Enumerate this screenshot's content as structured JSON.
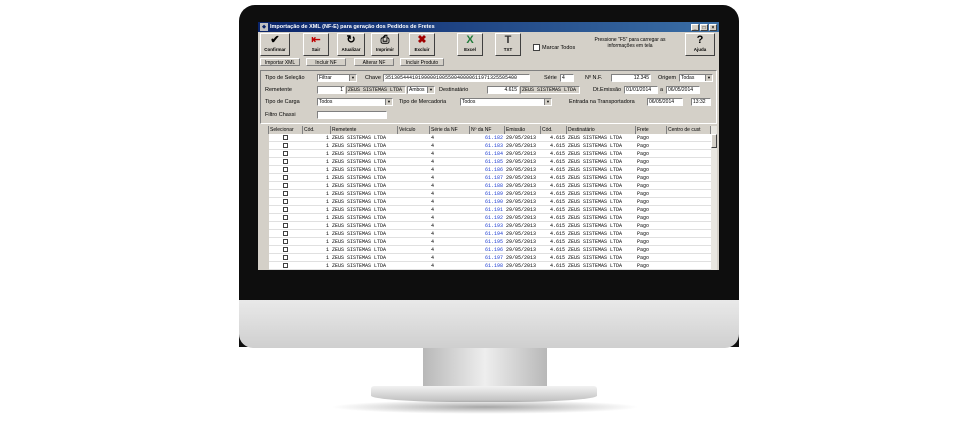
{
  "window": {
    "title": "Importação de XML (NF-E) para geração dos Pedidos de Fretes",
    "controls": [
      "_",
      "□",
      "×"
    ]
  },
  "toolbar": {
    "buttons": [
      {
        "label": "Confirmar",
        "icon": "checkmark-icon",
        "glyph": "✔"
      },
      {
        "label": "Sair",
        "icon": "door-exit-icon",
        "glyph": "⇤"
      },
      {
        "label": "Atualizar",
        "icon": "refresh-icon",
        "glyph": "↻"
      },
      {
        "label": "Imprimir",
        "icon": "printer-icon",
        "glyph": "⎙"
      },
      {
        "label": "Excluir",
        "icon": "delete-doc-icon",
        "glyph": "✖"
      },
      {
        "label": "Excel",
        "icon": "excel-icon",
        "glyph": "X"
      },
      {
        "label": "TXT",
        "icon": "txt-icon",
        "glyph": "T"
      },
      {
        "label": "Ajuda",
        "icon": "help-icon",
        "glyph": "?"
      }
    ],
    "marcar_todos": "Marcar Todos",
    "hint": "Pressione \"F5\" para carregar as informações em tela"
  },
  "subtabs": [
    "Importar XML",
    "Incluir NF",
    "Alterar NF",
    "Incluir Produto"
  ],
  "filters": {
    "tipo_selecao_label": "Tipo de Seleção",
    "tipo_selecao_value": "Filtrar",
    "chave_label": "Chave",
    "chave_value": "35130544410199000100550040000611971325505400",
    "serie_label": "Série",
    "serie_value": "4",
    "nf_label": "Nº N.F.",
    "nf_value": "12.345",
    "origem_label": "Origem",
    "origem_value": "Todas",
    "remetente_label": "Remetente",
    "remetente_code": "1",
    "remetente_name": "ZEUS SISTEMAS LTDA",
    "ambos_value": "Ambos",
    "destinatario_label": "Destinatário",
    "destinatario_code": "4.615",
    "destinatario_name": "ZEUS SISTEMAS LTDA",
    "dt_emissao_label": "Dt.Emissão",
    "dt_from": "01/01/2014",
    "dt_sep": "a",
    "dt_to": "06/05/2014",
    "tipo_carga_label": "Tipo de Carga",
    "tipo_carga_value": "Todos",
    "tipo_mercadoria_label": "Tipo de Mercadoria",
    "tipo_mercadoria_value": "Todos",
    "entrada_label": "Entrada na Transportadora",
    "entrada_date": "06/05/2014",
    "entrada_time": "13:32",
    "filtro_chassi_label": "Filtro Chassi",
    "filtro_chassi_value": ""
  },
  "table": {
    "columns": [
      "Selecionar",
      "Cód.",
      "Remetente",
      "Veículo",
      "Série da NF",
      "Nº da NF",
      "Emissão",
      "Cód.",
      "Destinatário",
      "Frete",
      "Centro de cust"
    ],
    "rows": [
      {
        "cod": "1",
        "remetente": "ZEUS SISTEMAS LTDA",
        "serie": "4",
        "nf": "61.182",
        "emissao": "29/05/2013",
        "cod2": "4.615",
        "dest": "ZEUS SISTEMAS LTDA",
        "frete": "Pago"
      },
      {
        "cod": "1",
        "remetente": "ZEUS SISTEMAS LTDA",
        "serie": "4",
        "nf": "61.183",
        "emissao": "29/05/2013",
        "cod2": "4.615",
        "dest": "ZEUS SISTEMAS LTDA",
        "frete": "Pago"
      },
      {
        "cod": "1",
        "remetente": "ZEUS SISTEMAS LTDA",
        "serie": "4",
        "nf": "61.184",
        "emissao": "29/05/2013",
        "cod2": "4.615",
        "dest": "ZEUS SISTEMAS LTDA",
        "frete": "Pago"
      },
      {
        "cod": "1",
        "remetente": "ZEUS SISTEMAS LTDA",
        "serie": "4",
        "nf": "61.185",
        "emissao": "29/05/2013",
        "cod2": "4.615",
        "dest": "ZEUS SISTEMAS LTDA",
        "frete": "Pago"
      },
      {
        "cod": "1",
        "remetente": "ZEUS SISTEMAS LTDA",
        "serie": "4",
        "nf": "61.186",
        "emissao": "29/05/2013",
        "cod2": "4.615",
        "dest": "ZEUS SISTEMAS LTDA",
        "frete": "Pago"
      },
      {
        "cod": "1",
        "remetente": "ZEUS SISTEMAS LTDA",
        "serie": "4",
        "nf": "61.187",
        "emissao": "29/05/2013",
        "cod2": "4.615",
        "dest": "ZEUS SISTEMAS LTDA",
        "frete": "Pago"
      },
      {
        "cod": "1",
        "remetente": "ZEUS SISTEMAS LTDA",
        "serie": "4",
        "nf": "61.188",
        "emissao": "29/05/2013",
        "cod2": "4.615",
        "dest": "ZEUS SISTEMAS LTDA",
        "frete": "Pago"
      },
      {
        "cod": "1",
        "remetente": "ZEUS SISTEMAS LTDA",
        "serie": "4",
        "nf": "61.189",
        "emissao": "29/05/2013",
        "cod2": "4.615",
        "dest": "ZEUS SISTEMAS LTDA",
        "frete": "Pago"
      },
      {
        "cod": "1",
        "remetente": "ZEUS SISTEMAS LTDA",
        "serie": "4",
        "nf": "61.190",
        "emissao": "29/05/2013",
        "cod2": "4.615",
        "dest": "ZEUS SISTEMAS LTDA",
        "frete": "Pago"
      },
      {
        "cod": "1",
        "remetente": "ZEUS SISTEMAS LTDA",
        "serie": "4",
        "nf": "61.191",
        "emissao": "29/05/2013",
        "cod2": "4.615",
        "dest": "ZEUS SISTEMAS LTDA",
        "frete": "Pago"
      },
      {
        "cod": "1",
        "remetente": "ZEUS SISTEMAS LTDA",
        "serie": "4",
        "nf": "61.192",
        "emissao": "29/05/2013",
        "cod2": "4.615",
        "dest": "ZEUS SISTEMAS LTDA",
        "frete": "Pago"
      },
      {
        "cod": "1",
        "remetente": "ZEUS SISTEMAS LTDA",
        "serie": "4",
        "nf": "61.193",
        "emissao": "29/05/2013",
        "cod2": "4.615",
        "dest": "ZEUS SISTEMAS LTDA",
        "frete": "Pago"
      },
      {
        "cod": "1",
        "remetente": "ZEUS SISTEMAS LTDA",
        "serie": "4",
        "nf": "61.194",
        "emissao": "29/05/2013",
        "cod2": "4.615",
        "dest": "ZEUS SISTEMAS LTDA",
        "frete": "Pago"
      },
      {
        "cod": "1",
        "remetente": "ZEUS SISTEMAS LTDA",
        "serie": "4",
        "nf": "61.195",
        "emissao": "29/05/2013",
        "cod2": "4.615",
        "dest": "ZEUS SISTEMAS LTDA",
        "frete": "Pago"
      },
      {
        "cod": "1",
        "remetente": "ZEUS SISTEMAS LTDA",
        "serie": "4",
        "nf": "61.196",
        "emissao": "29/05/2013",
        "cod2": "4.615",
        "dest": "ZEUS SISTEMAS LTDA",
        "frete": "Pago"
      },
      {
        "cod": "1",
        "remetente": "ZEUS SISTEMAS LTDA",
        "serie": "4",
        "nf": "61.197",
        "emissao": "29/05/2013",
        "cod2": "4.615",
        "dest": "ZEUS SISTEMAS LTDA",
        "frete": "Pago"
      },
      {
        "cod": "1",
        "remetente": "ZEUS SISTEMAS LTDA",
        "serie": "4",
        "nf": "61.198",
        "emissao": "29/05/2013",
        "cod2": "4.615",
        "dest": "ZEUS SISTEMAS LTDA",
        "frete": "Pago"
      }
    ]
  },
  "colors": {
    "titlebar": "#0a246a",
    "window_bg": "#d4d0c8",
    "nf_text": "#1a3ad0"
  }
}
